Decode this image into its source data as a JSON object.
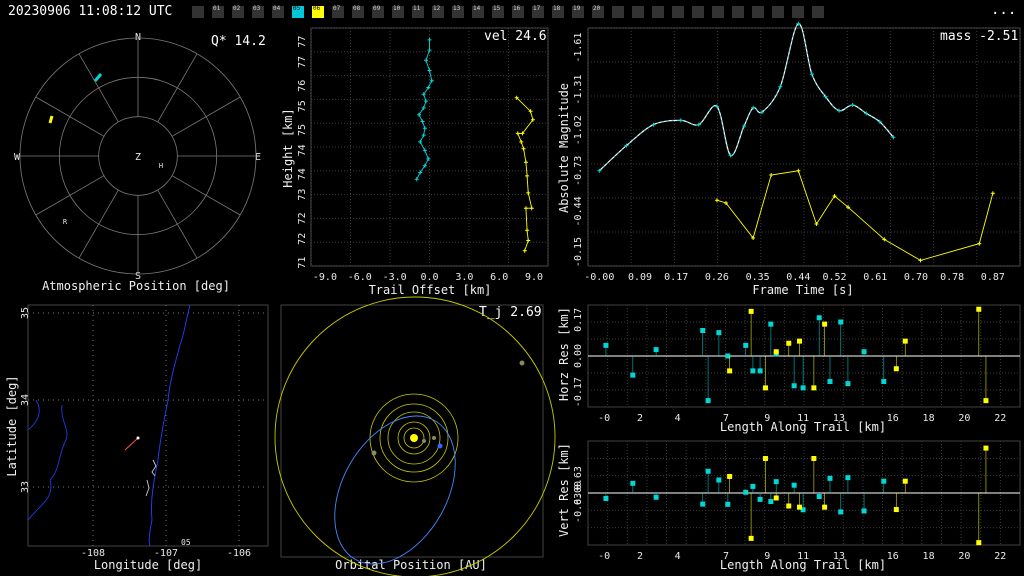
{
  "header": {
    "timestamp": "20230906 11:08:12 UTC",
    "menu": "..."
  },
  "station_bar": {
    "labels": [
      "01",
      "02",
      "03",
      "04",
      "05",
      "06",
      "07",
      "08",
      "09",
      "10",
      "11",
      "12",
      "13",
      "14",
      "15",
      "16",
      "17",
      "18",
      "19",
      "20"
    ],
    "active": [
      {
        "label": "05",
        "color": "#00c8d8"
      },
      {
        "label": "06",
        "color": "#ffff00"
      }
    ]
  },
  "colors": {
    "cyan": "#00d8d8",
    "yellow": "#ffff00",
    "grid": "#3a3a3a",
    "axis": "#ffffff"
  },
  "chart_data": [
    {
      "id": "atmospheric",
      "type": "polar",
      "xlabel": "Atmospheric Position [deg]",
      "annotation": "Q* 14.2",
      "cardinals": [
        "N",
        "E",
        "S",
        "W"
      ],
      "center_label": "Z",
      "markers": [
        "H",
        "R"
      ]
    },
    {
      "id": "height",
      "type": "line",
      "xlabel": "Trail Offset [km]",
      "ylabel": "Height [km]",
      "annotation": "vel 24.6",
      "xticks": [
        "-9.0",
        "-6.0",
        "-3.0",
        "0.0",
        "3.0",
        "6.0",
        "9.0"
      ],
      "yticks": [
        "71",
        "72",
        "72",
        "73",
        "74",
        "74",
        "75",
        "75",
        "76",
        "77",
        "77"
      ],
      "xlim": [
        -10.2,
        10.2
      ],
      "ylim": [
        70.9,
        77.9
      ],
      "series": [
        {
          "x": [
            0.0,
            0.0,
            -0.3,
            0.0,
            0.2,
            -0.1,
            -0.5,
            -0.3,
            -0.5,
            -0.9,
            -0.6,
            -0.4,
            -0.5,
            -0.8,
            -0.4,
            -0.1,
            -0.4,
            -0.8,
            -1.1
          ],
          "y": [
            77.55,
            77.25,
            76.95,
            76.65,
            76.35,
            76.15,
            75.95,
            75.75,
            75.55,
            75.35,
            75.15,
            74.95,
            74.75,
            74.55,
            74.3,
            74.05,
            73.85,
            73.65,
            73.45
          ]
        },
        {
          "x": [
            7.5,
            8.7,
            8.9,
            8.0,
            7.6,
            7.9,
            8.1,
            8.3,
            8.4,
            8.5,
            8.8,
            8.3,
            8.4,
            8.5,
            8.2
          ],
          "y": [
            75.85,
            75.45,
            75.2,
            74.8,
            74.8,
            74.55,
            74.35,
            73.95,
            73.55,
            73.05,
            72.6,
            72.6,
            71.95,
            71.65,
            71.35
          ]
        }
      ]
    },
    {
      "id": "magnitude",
      "type": "line",
      "xlabel": "Frame Time [s]",
      "ylabel": "Absolute Magnitude",
      "annotation": "mass -2.51",
      "xticks": [
        "-0.00",
        "0.09",
        "0.17",
        "0.26",
        "0.35",
        "0.44",
        "0.52",
        "0.61",
        "0.70",
        "0.78",
        "0.87"
      ],
      "yticks": [
        "-1.61",
        "-1.31",
        "-1.02",
        "-0.73",
        "-0.44",
        "-0.15"
      ],
      "series": [
        {
          "x": [
            0.0,
            0.06,
            0.12,
            0.18,
            0.22,
            0.26,
            0.29,
            0.32,
            0.34,
            0.36,
            0.4,
            0.44,
            0.47,
            0.5,
            0.53,
            0.56,
            0.59,
            0.62,
            0.65
          ],
          "y": [
            -0.73,
            -0.91,
            -1.06,
            -1.09,
            -1.06,
            -1.19,
            -0.84,
            -1.05,
            -1.18,
            -1.15,
            -1.33,
            -1.78,
            -1.42,
            -1.26,
            -1.16,
            -1.2,
            -1.14,
            -1.08,
            -0.97
          ]
        },
        {
          "x": [
            0.26,
            0.28,
            0.34,
            0.38,
            0.44,
            0.48,
            0.52,
            0.55,
            0.63,
            0.71,
            0.84,
            0.87
          ],
          "y": [
            -0.52,
            -0.5,
            -0.25,
            -0.7,
            -0.73,
            -0.35,
            -0.55,
            -0.47,
            -0.24,
            -0.09,
            -0.21,
            -0.57
          ]
        }
      ]
    },
    {
      "id": "map",
      "type": "map",
      "xlabel": "Longitude [deg]",
      "ylabel": "Latitude [deg]",
      "xticks": [
        "-108",
        "-107",
        "-106"
      ],
      "yticks": [
        "33",
        "34",
        "35"
      ],
      "corner_label": "05"
    },
    {
      "id": "orbit",
      "type": "orbital",
      "xlabel": "Orbital Position [AU]",
      "annotation": "T_j 2.69"
    },
    {
      "id": "horz_res",
      "type": "scatter",
      "xlabel": "Length Along Trail [km]",
      "ylabel": "Horz Res [km]",
      "xticks": [
        "-0",
        "2",
        "4",
        "7",
        "9",
        "11",
        "13",
        "16",
        "18",
        "20",
        "22"
      ],
      "yticks": [
        "0.17",
        "0.00",
        "-0.17"
      ],
      "series": [
        {
          "x": [
            0,
            1.5,
            2.8,
            5.4,
            5.7,
            6.3,
            6.8,
            7.8,
            8.2,
            8.6,
            9.2,
            9.5,
            10.5,
            11.0,
            11.9,
            12.5,
            13.1,
            13.5,
            14.4,
            15.5
          ],
          "y": [
            0.05,
            -0.09,
            0.03,
            0.12,
            -0.21,
            0.11,
            0.0,
            0.05,
            -0.07,
            -0.07,
            0.15,
            0.01,
            -0.14,
            -0.15,
            0.18,
            -0.12,
            0.16,
            -0.13,
            0.02,
            -0.12
          ]
        },
        {
          "x": [
            6.9,
            8.1,
            8.9,
            9.5,
            10.2,
            10.8,
            11.6,
            12.2,
            16.2,
            16.7,
            20.8,
            21.2
          ],
          "y": [
            -0.07,
            0.21,
            -0.15,
            0.02,
            0.06,
            0.07,
            -0.15,
            0.15,
            -0.06,
            0.07,
            0.22,
            -0.21
          ]
        }
      ]
    },
    {
      "id": "vert_res",
      "type": "scatter",
      "xlabel": "Length Along Trail [km]",
      "ylabel": "Vert Res [km]",
      "xticks": [
        "-0",
        "2",
        "4",
        "7",
        "9",
        "11",
        "13",
        "16",
        "18",
        "20",
        "22"
      ],
      "yticks": [
        "0.63",
        "0.00",
        "-0.63"
      ],
      "series": [
        {
          "x": [
            0,
            1.5,
            2.8,
            5.4,
            5.7,
            6.3,
            6.8,
            7.8,
            8.2,
            8.6,
            9.2,
            9.5,
            10.5,
            11.0,
            11.9,
            12.5,
            13.1,
            13.5,
            14.4,
            15.5
          ],
          "y": [
            -0.23,
            0.41,
            -0.18,
            -0.47,
            0.92,
            0.55,
            -0.48,
            0.03,
            0.28,
            -0.27,
            -0.36,
            0.48,
            0.33,
            -0.71,
            -0.15,
            0.62,
            -0.8,
            0.65,
            -0.76,
            0.5
          ]
        },
        {
          "x": [
            6.9,
            8.1,
            8.9,
            9.5,
            10.2,
            10.8,
            11.6,
            12.2,
            16.2,
            16.7,
            20.8,
            21.2
          ],
          "y": [
            0.7,
            -1.92,
            1.46,
            -0.21,
            -0.55,
            -0.6,
            1.46,
            -0.6,
            -0.7,
            0.5,
            -2.1,
            1.9
          ]
        }
      ]
    }
  ]
}
